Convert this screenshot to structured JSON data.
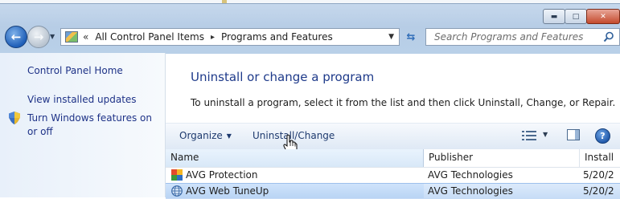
{
  "window": {
    "minimize_glyph": "▬",
    "maximize_glyph": "□",
    "close_glyph": "✕"
  },
  "address_bar": {
    "chevron": "«",
    "breadcrumbs": [
      "All Control Panel Items",
      "Programs and Features"
    ],
    "separator": "▸"
  },
  "search": {
    "placeholder": "Search Programs and Features"
  },
  "sidebar": {
    "links": [
      {
        "label": "Control Panel Home"
      },
      {
        "label": "View installed updates"
      },
      {
        "label": "Turn Windows features on or off",
        "icon": "shield-icon"
      }
    ]
  },
  "main": {
    "heading": "Uninstall or change a program",
    "description": "To uninstall a program, select it from the list and then click Uninstall, Change, or Repair."
  },
  "toolbar": {
    "organize": "Organize",
    "uninstall_change": "Uninstall/Change",
    "help_glyph": "?"
  },
  "list": {
    "columns": [
      "Name",
      "Publisher",
      "Install"
    ],
    "rows": [
      {
        "name": "AVG Protection",
        "publisher": "AVG Technologies",
        "installed": "5/20/2",
        "selected": false,
        "icon": "avg-icon"
      },
      {
        "name": "AVG Web TuneUp",
        "publisher": "AVG Technologies",
        "installed": "5/20/2",
        "selected": true,
        "icon": "globe-icon"
      }
    ]
  },
  "colors": {
    "link": "#1e3287",
    "heading": "#1e3a8a",
    "selection": "#c6dcf6"
  }
}
